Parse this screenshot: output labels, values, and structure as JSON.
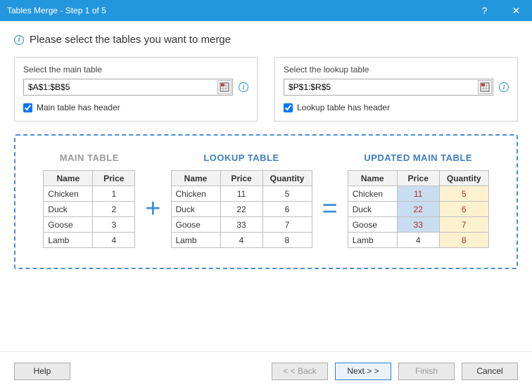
{
  "window": {
    "title": "Tables Merge - Step 1 of 5",
    "help_glyph": "?",
    "close_glyph": "✕"
  },
  "instruction": "Please select the tables you want to merge",
  "main_select": {
    "legend": "Select the main table",
    "value": "$A$1:$B$5",
    "checkbox_label": "Main table has header",
    "checked": true
  },
  "lookup_select": {
    "legend": "Select the lookup table",
    "value": "$P$1:$R$5",
    "checkbox_label": "Lookup table has header",
    "checked": true
  },
  "preview": {
    "main": {
      "caption": "MAIN TABLE",
      "headers": [
        "Name",
        "Price"
      ],
      "rows": [
        [
          "Chicken",
          "1"
        ],
        [
          "Duck",
          "2"
        ],
        [
          "Goose",
          "3"
        ],
        [
          "Lamb",
          "4"
        ]
      ]
    },
    "lookup": {
      "caption": "LOOKUP TABLE",
      "headers": [
        "Name",
        "Price",
        "Quantity"
      ],
      "rows": [
        [
          "Chicken",
          "11",
          "5"
        ],
        [
          "Duck",
          "22",
          "6"
        ],
        [
          "Goose",
          "33",
          "7"
        ],
        [
          "Lamb",
          "4",
          "8"
        ]
      ]
    },
    "updated": {
      "caption": "UPDATED MAIN TABLE",
      "headers": [
        "Name",
        "Price",
        "Quantity"
      ],
      "rows": [
        [
          "Chicken",
          "11",
          "5"
        ],
        [
          "Duck",
          "22",
          "6"
        ],
        [
          "Goose",
          "33",
          "7"
        ],
        [
          "Lamb",
          "4",
          "8"
        ]
      ]
    },
    "plus": "+",
    "equals": "="
  },
  "footer": {
    "help": "Help",
    "back": "< < Back",
    "next": "Next > >",
    "finish": "Finish",
    "cancel": "Cancel"
  }
}
